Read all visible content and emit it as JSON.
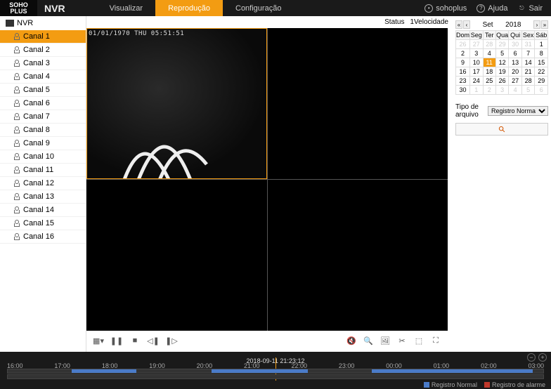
{
  "header": {
    "logo_line1": "SOHO",
    "logo_line2": "PLUS",
    "brand": "NVR",
    "tabs": {
      "visualize": "Visualizar",
      "playback": "Reprodução",
      "config": "Configuração"
    },
    "user": "sohoplus",
    "help": "Ajuda",
    "logout": "Sair"
  },
  "sidebar": {
    "root": "NVR",
    "channels": [
      "Canal 1",
      "Canal 2",
      "Canal 3",
      "Canal 4",
      "Canal 5",
      "Canal 6",
      "Canal 7",
      "Canal 8",
      "Canal 9",
      "Canal 10",
      "Canal 11",
      "Canal 12",
      "Canal 13",
      "Canal 14",
      "Canal 15",
      "Canal 16"
    ],
    "active_index": 0
  },
  "status": {
    "label": "Status",
    "speed": "1Velocidade"
  },
  "video": {
    "feed_timestamp": "01/01/1970 THU 05:51:51"
  },
  "calendar": {
    "month": "Set",
    "year": "2018",
    "weekdays": [
      "Dom",
      "Seg",
      "Ter",
      "Qua",
      "Qui",
      "Sex",
      "Sáb"
    ],
    "prev_days": [
      26,
      27,
      28,
      29,
      30,
      31
    ],
    "days": [
      1,
      2,
      3,
      4,
      5,
      6,
      7,
      8,
      9,
      10,
      11,
      12,
      13,
      14,
      15,
      16,
      17,
      18,
      19,
      20,
      21,
      22,
      23,
      24,
      25,
      26,
      27,
      28,
      29,
      30
    ],
    "next_days": [
      1,
      2,
      3,
      4,
      5,
      6
    ],
    "today": 11
  },
  "filebar": {
    "label": "Tipo de arquivo",
    "option": "Registro Norma"
  },
  "timeline": {
    "marker": "2018-09-11 21:23:12",
    "hours": [
      "16:00",
      "17:00",
      "18:00",
      "19:00",
      "20:00",
      "21:00",
      "22:00",
      "23:00",
      "00:00",
      "01:00",
      "02:00",
      "03:00"
    ],
    "legend_normal": "Registro Normal",
    "legend_alarm": "Registro de alarme",
    "color_normal": "#4a7bc8",
    "color_alarm": "#c0392b"
  }
}
